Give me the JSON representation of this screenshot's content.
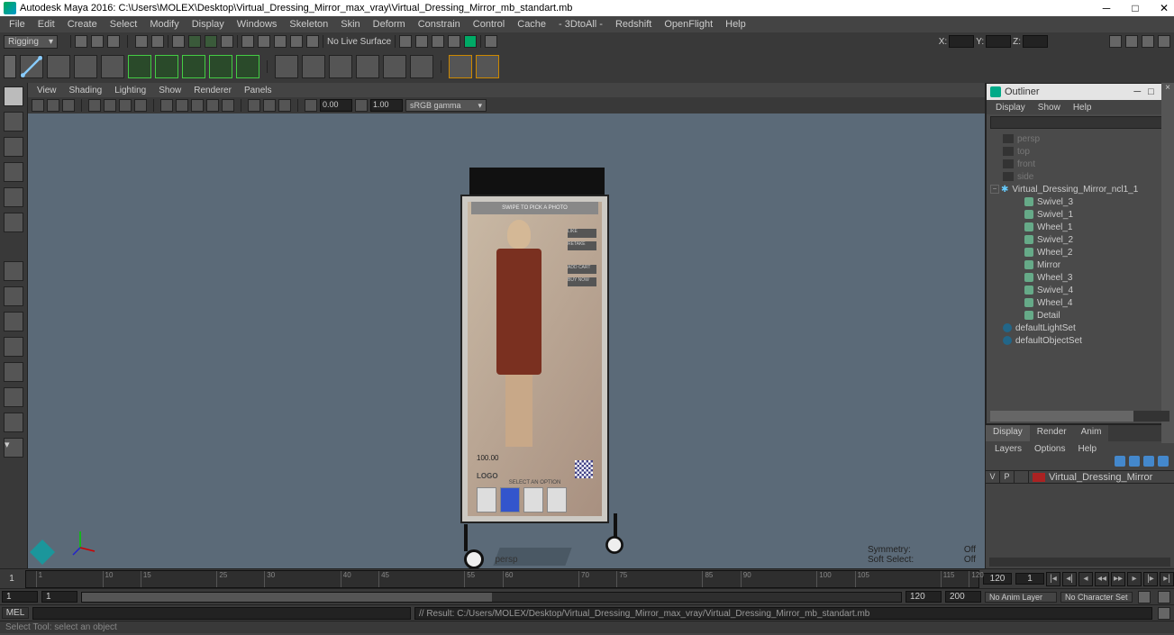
{
  "title": "Autodesk Maya 2016: C:\\Users\\MOLEX\\Desktop\\Virtual_Dressing_Mirror_max_vray\\Virtual_Dressing_Mirror_mb_standart.mb",
  "menubar": [
    "File",
    "Edit",
    "Create",
    "Select",
    "Modify",
    "Display",
    "Windows",
    "Skeleton",
    "Skin",
    "Deform",
    "Constrain",
    "Control",
    "Cache",
    "- 3DtoAll -",
    "Redshift",
    "OpenFlight",
    "Help"
  ],
  "module_dd": "Rigging",
  "nolive": "No Live Surface",
  "xyz": {
    "x": "X:",
    "y": "Y:",
    "z": "Z:"
  },
  "vp_menus": [
    "View",
    "Shading",
    "Lighting",
    "Show",
    "Renderer",
    "Panels"
  ],
  "vp_num1": "0.00",
  "vp_num2": "1.00",
  "gamma": "sRGB gamma",
  "persp": "persp",
  "hud": {
    "sym_l": "Symmetry:",
    "sym_v": "Off",
    "ss_l": "Soft Select:",
    "ss_v": "Off"
  },
  "outliner": {
    "title": "Outliner",
    "menus": [
      "Display",
      "Show",
      "Help"
    ],
    "cams": [
      "persp",
      "top",
      "front",
      "side"
    ],
    "root": "Virtual_Dressing_Mirror_ncl1_1",
    "children": [
      "Swivel_3",
      "Swivel_1",
      "Wheel_1",
      "Swivel_2",
      "Wheel_2",
      "Mirror",
      "Wheel_3",
      "Swivel_4",
      "Wheel_4",
      "Detail"
    ],
    "sets": [
      "defaultLightSet",
      "defaultObjectSet"
    ]
  },
  "channel": {
    "tabs": [
      "Display",
      "Render",
      "Anim"
    ],
    "menus": [
      "Layers",
      "Options",
      "Help"
    ],
    "layer_v": "V",
    "layer_p": "P",
    "layer_name": "Virtual_Dressing_Mirror"
  },
  "time": {
    "start_frame": "1",
    "end_label": "120",
    "ticks": [
      "1",
      "15",
      "30",
      "45",
      "60",
      "75",
      "90",
      "105",
      "120"
    ],
    "tick_nums": [
      "10",
      "25",
      "40",
      "55",
      "70",
      "85",
      "100",
      "115"
    ],
    "range_start": "1",
    "range_s2": "1",
    "range_e1": "120",
    "range_e2": "200",
    "animlayer": "No Anim Layer",
    "charset": "No Character Set"
  },
  "mel": "MEL",
  "result": "// Result: C:/Users/MOLEX/Desktop/Virtual_Dressing_Mirror_max_vray/Virtual_Dressing_Mirror_mb_standart.mb",
  "helpline": "Select Tool: select an object",
  "mirror_ui": {
    "banner": "SWIPE TO PICK A PHOTO",
    "btns": [
      "LIKE",
      "RETAKE",
      "ADD CART",
      "BUY NOW"
    ],
    "price": "100.00",
    "logo": "LOGO",
    "optlabel": "SELECT AN OPTION"
  }
}
